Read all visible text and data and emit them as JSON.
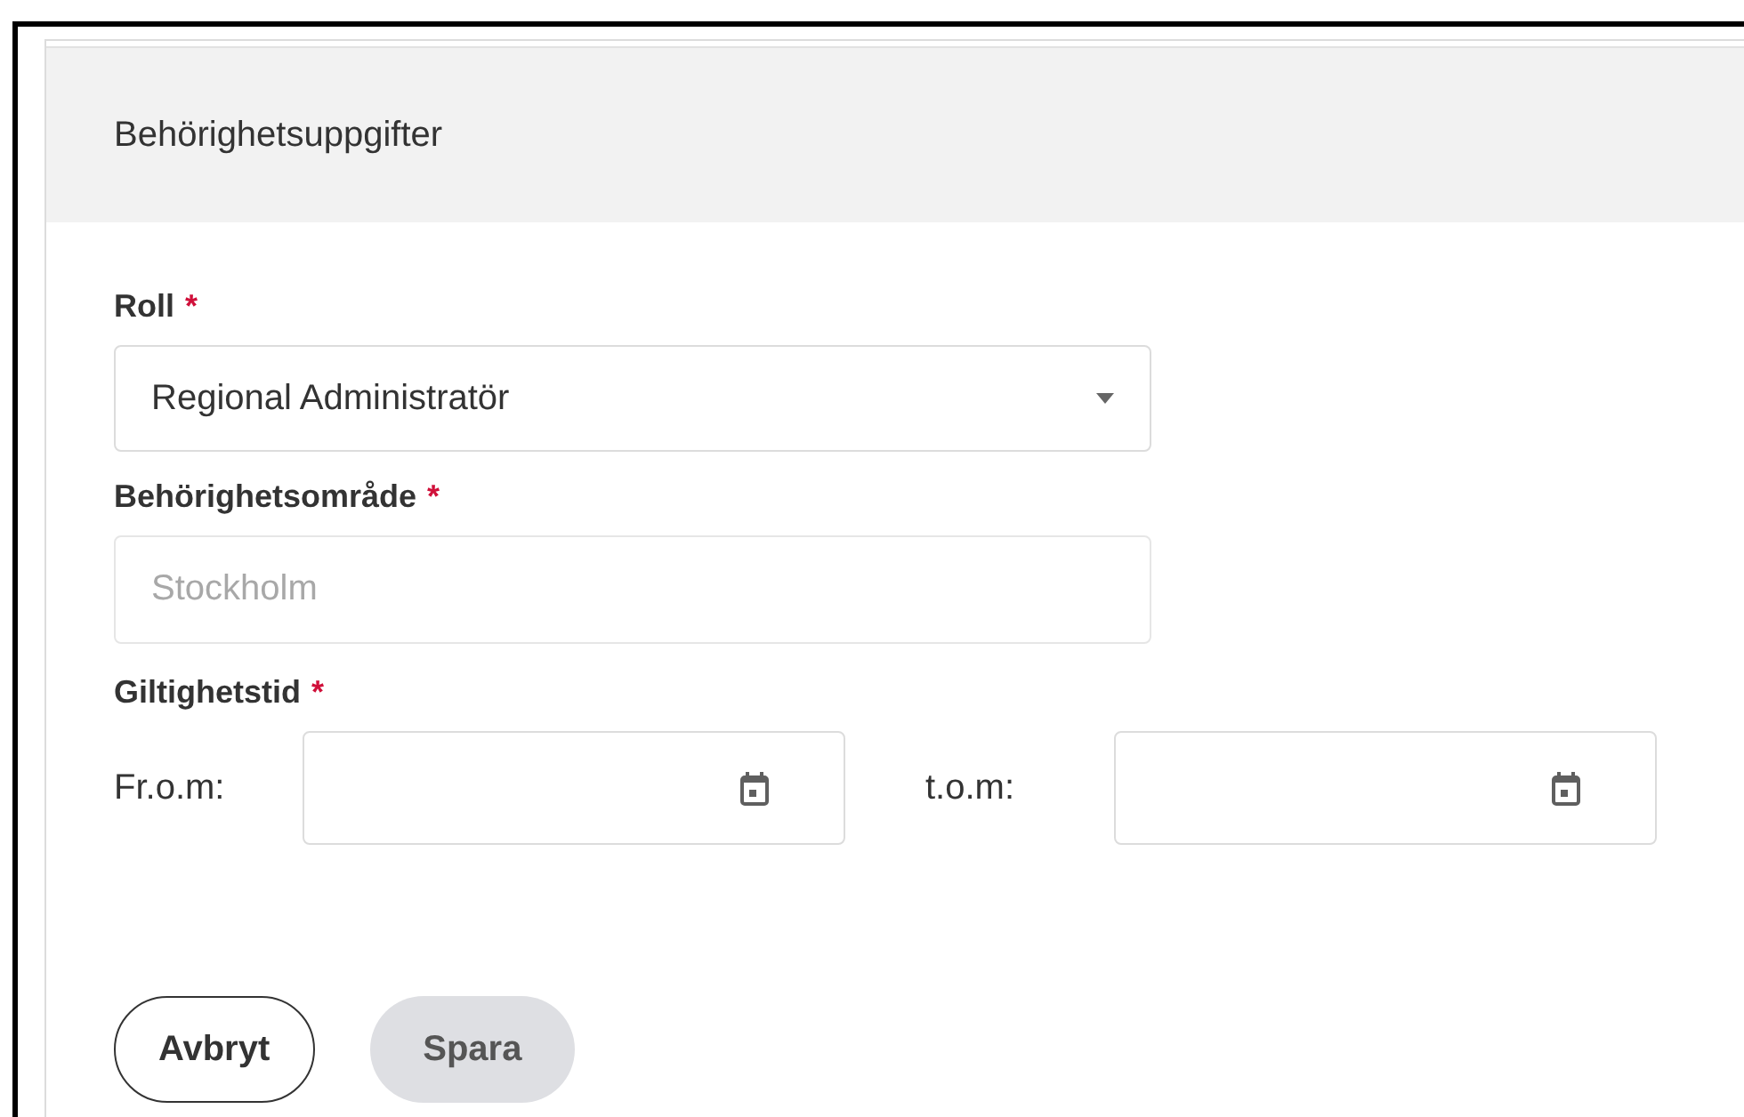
{
  "section": {
    "title": "Behörighetsuppgifter"
  },
  "role": {
    "label": "Roll",
    "required": true,
    "value": "Regional Administratör"
  },
  "area": {
    "label": "Behörighetsområde",
    "required": true,
    "placeholder": "Stockholm"
  },
  "validity": {
    "label": "Giltighetstid",
    "required": true,
    "required_mark": "*",
    "fields": [
      {
        "label": "Fr.o.m:"
      },
      {
        "label": "t.o.m:"
      }
    ]
  },
  "buttons": [
    {
      "label": "Avbryt",
      "kind": "outline",
      "disabled": false
    },
    {
      "label": "Spara",
      "kind": "filled",
      "disabled": true
    }
  ]
}
